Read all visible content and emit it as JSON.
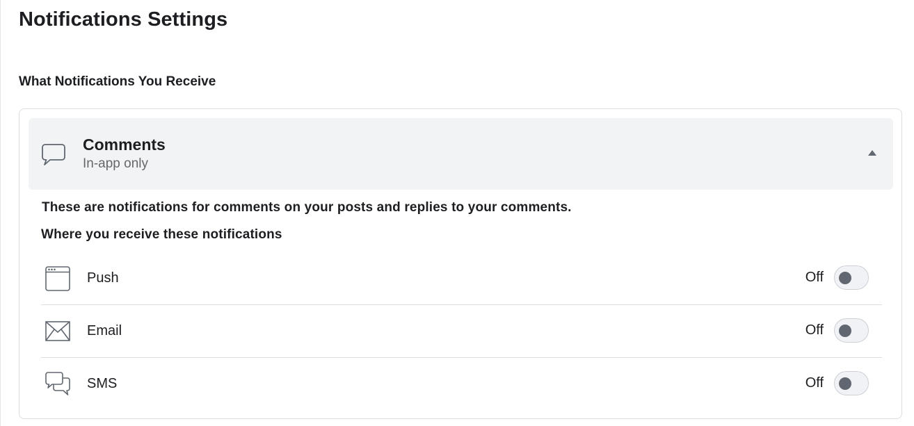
{
  "page": {
    "title": "Notifications Settings"
  },
  "section": {
    "title": "What Notifications You Receive"
  },
  "category": {
    "icon": "speech-bubble-icon",
    "title": "Comments",
    "subtitle": "In-app only",
    "expanded": true,
    "toggle_icon": "caret-up-icon",
    "description": "These are notifications for comments on your posts and replies to your comments.",
    "where_title": "Where you receive these notifications"
  },
  "channels": [
    {
      "icon": "browser-window-icon",
      "label": "Push",
      "state": "Off",
      "enabled": false
    },
    {
      "icon": "envelope-icon",
      "label": "Email",
      "state": "Off",
      "enabled": false
    },
    {
      "icon": "chat-bubbles-icon",
      "label": "SMS",
      "state": "Off",
      "enabled": false
    }
  ],
  "colors": {
    "header_background": "#f2f3f5",
    "secondary_text": "#65676b",
    "toggle_knob": "#606770",
    "border": "#dadde1"
  }
}
